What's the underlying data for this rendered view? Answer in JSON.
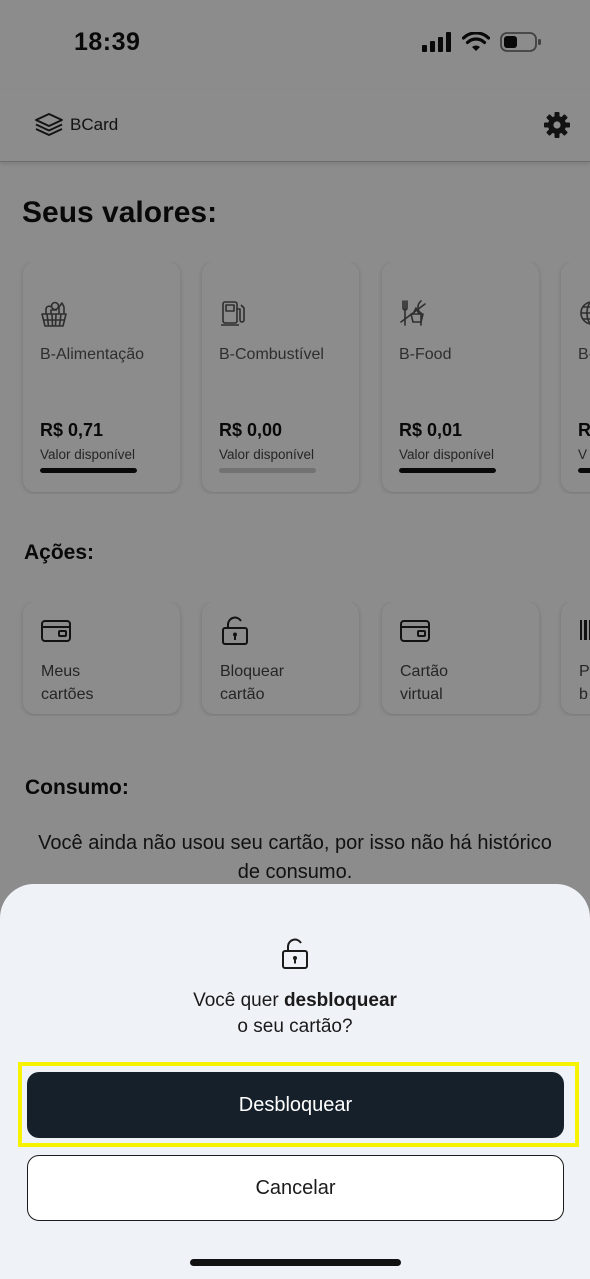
{
  "status_bar": {
    "time": "18:39"
  },
  "header": {
    "logo_text": "BCard"
  },
  "balances": {
    "title": "Seus valores:",
    "items": [
      {
        "name": "B-Alimentação",
        "value": "R$ 0,71",
        "label": "Valor disponível",
        "icon": "grocery-basket-icon",
        "bar_fill": 1.0
      },
      {
        "name": "B-Combustível",
        "value": "R$ 0,00",
        "label": "Valor disponível",
        "icon": "fuel-pump-icon",
        "bar_fill": 0.0
      },
      {
        "name": "B-Food",
        "value": "R$ 0,01",
        "label": "Valor disponível",
        "icon": "restaurant-icon",
        "bar_fill": 1.0
      },
      {
        "name": "B-",
        "value": "R",
        "label": "V",
        "icon": "globe-icon",
        "bar_fill": 1.0
      }
    ]
  },
  "actions": {
    "title": "Ações:",
    "items": [
      {
        "label": "Meus cartões",
        "icon": "credit-card-icon"
      },
      {
        "label": "Bloquear cartão",
        "icon": "padlock-icon"
      },
      {
        "label": "Cartão virtual",
        "icon": "credit-card-icon"
      },
      {
        "label": "Pa b",
        "icon": "barcode-icon"
      }
    ]
  },
  "consumo": {
    "title": "Consumo:",
    "empty_message": "Você ainda não usou seu cartão, por isso não há histórico de consumo."
  },
  "dialog": {
    "icon": "unlock-icon",
    "question_prefix": "Você quer",
    "question_bold": "desbloquear",
    "question_suffix": "o seu cartão?",
    "confirm_label": "Desbloquear",
    "cancel_label": "Cancelar"
  },
  "colors": {
    "primary_button": "#16202b",
    "sheet_background": "#eff2f7",
    "highlight": "#f6f200"
  }
}
